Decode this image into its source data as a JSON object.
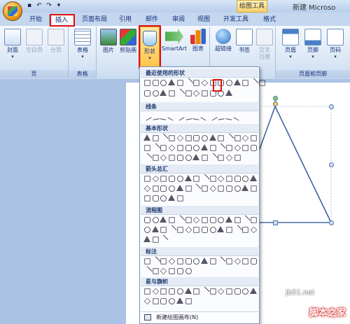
{
  "title_bar": {
    "drawing_tools_label": "绘图工具",
    "doc_title": "新建 Microso"
  },
  "tabs": [
    "开始",
    "插入",
    "页面布局",
    "引用",
    "邮件",
    "审阅",
    "视图",
    "开发工具",
    "格式"
  ],
  "ribbon": {
    "pages": {
      "cover": "封面",
      "blank": "空白页",
      "break": "分页",
      "group": "页"
    },
    "tables": {
      "table": "表格",
      "group": "表格"
    },
    "illustrations": {
      "picture": "图片",
      "clipart": "剪贴画",
      "shapes": "形状",
      "smartart": "SmartArt",
      "chart": "图表"
    },
    "links": {
      "hyperlink": "超链接",
      "bookmark": "书签",
      "crossref": "交叉\n引用"
    },
    "header_footer": {
      "header": "页眉",
      "footer": "页脚",
      "pagenum": "页码",
      "group": "页眉和页脚"
    }
  },
  "gallery": {
    "recent": "最近使用的形状",
    "lines": "线条",
    "basic": "基本形状",
    "arrows": "箭头总汇",
    "flowchart": "流程图",
    "callouts": "标注",
    "stars": "星与旗帜",
    "new_canvas": "新建绘图画布(N)"
  },
  "watermark": {
    "site": "jb51.net",
    "brand": "脚本之家"
  },
  "colors": {
    "highlight": "#e01010",
    "ribbon_bg": "#dbe7f6",
    "outline": "#4f74a8"
  }
}
